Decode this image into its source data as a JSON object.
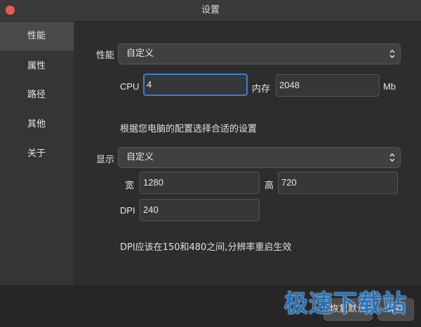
{
  "window": {
    "title": "设置"
  },
  "sidebar": {
    "items": [
      {
        "label": "性能",
        "active": true
      },
      {
        "label": "属性",
        "active": false
      },
      {
        "label": "路径",
        "active": false
      },
      {
        "label": "其他",
        "active": false
      },
      {
        "label": "关于",
        "active": false
      }
    ]
  },
  "performance": {
    "label": "性能",
    "select_value": "自定义",
    "cpu_label": "CPU",
    "cpu_value": "4",
    "memory_label": "内存",
    "memory_value": "2048",
    "memory_unit": "Mb",
    "hint": "根据您电脑的配置选择合适的设置"
  },
  "display": {
    "label": "显示",
    "select_value": "自定义",
    "width_label": "宽",
    "width_value": "1280",
    "height_label": "高",
    "height_value": "720",
    "dpi_label": "DPI",
    "dpi_value": "240",
    "hint": "DPI应该在150和480之间,分辨率重启生效"
  },
  "footer": {
    "restore_label": "恢复默认",
    "save_label": "保存"
  },
  "watermark": {
    "text": "极速下载站"
  },
  "colors": {
    "close_button": "#ee5a52",
    "focus_border": "#3b7fd6",
    "watermark": "#1e78c8"
  }
}
